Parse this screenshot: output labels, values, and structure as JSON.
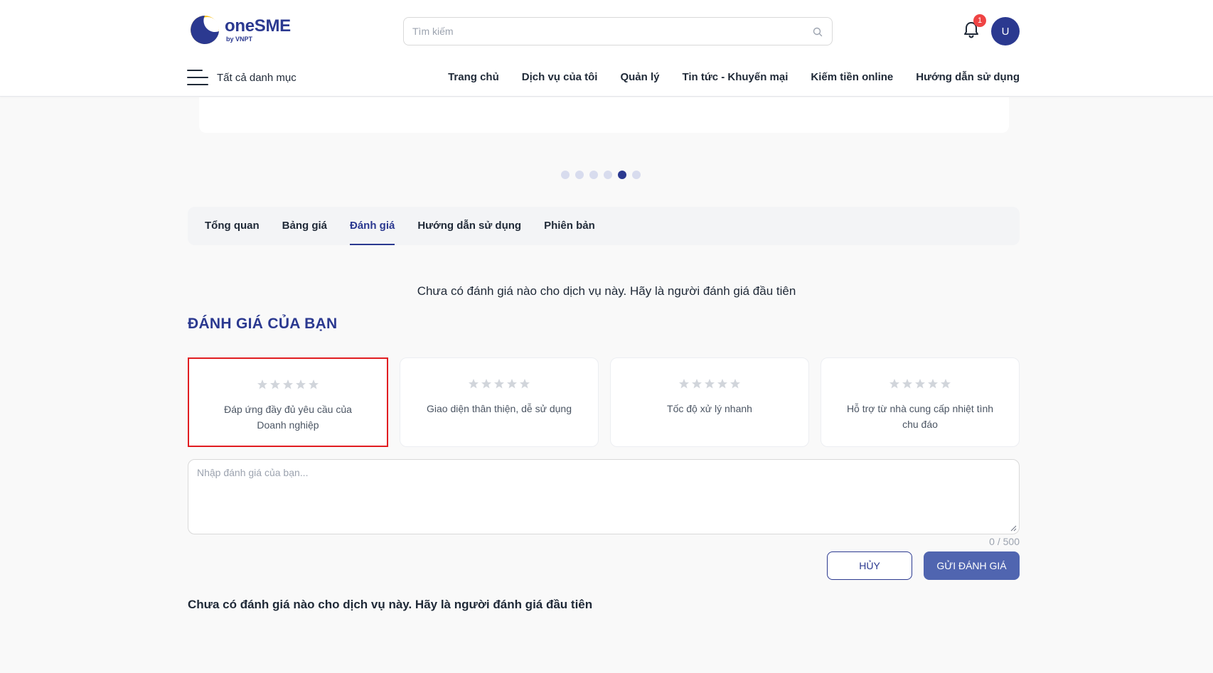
{
  "brand": {
    "name": "oneSME",
    "sub": "by VNPT",
    "color": "#2b3990",
    "accent": "#f9c11c"
  },
  "search": {
    "placeholder": "Tìm kiếm",
    "value": ""
  },
  "notifications": {
    "count": "1"
  },
  "user": {
    "initial": "U"
  },
  "menu": {
    "label": "Tất cả danh mục"
  },
  "nav": [
    {
      "label": "Trang chủ"
    },
    {
      "label": "Dịch vụ của tôi"
    },
    {
      "label": "Quản lý"
    },
    {
      "label": "Tin tức - Khuyến mại"
    },
    {
      "label": "Kiếm tiền online"
    },
    {
      "label": "Hướng dẫn sử dụng"
    }
  ],
  "carousel": {
    "slide_count": 6,
    "active_index": 4
  },
  "tabs": [
    {
      "label": "Tổng quan",
      "active": false
    },
    {
      "label": "Bảng giá",
      "active": false
    },
    {
      "label": "Đánh giá",
      "active": true
    },
    {
      "label": "Hướng dẫn sử dụng",
      "active": false
    },
    {
      "label": "Phiên bản",
      "active": false
    }
  ],
  "review": {
    "empty_message": "Chưa có đánh giá nào cho dịch vụ này. Hãy là người đánh giá đầu tiên",
    "section_title": "ĐÁNH GIÁ CỦA BẠN",
    "criteria": [
      {
        "label": "Đáp ứng đầy đủ yêu cầu của Doanh nghiệp",
        "rating": 0,
        "selected": true
      },
      {
        "label": "Giao diện thân thiện, dễ sử dụng",
        "rating": 0,
        "selected": false
      },
      {
        "label": "Tốc độ xử lý nhanh",
        "rating": 0,
        "selected": false
      },
      {
        "label": "Hỗ trợ từ nhà cung cấp nhiệt tình chu đáo",
        "rating": 0,
        "selected": false
      }
    ],
    "max_rating": 5,
    "textarea_placeholder": "Nhập đánh giá của bạn...",
    "counter": "0 / 500",
    "cancel_label": "HỦY",
    "submit_label": "GỬI ĐÁNH GIÁ",
    "bottom_message": "Chưa có đánh giá nào cho dịch vụ này. Hãy là người đánh giá đầu tiên"
  },
  "colors": {
    "primary": "#2b3990",
    "submit_bg": "#5065b0",
    "highlight_border": "#e11d21",
    "star_empty": "#d1d5db"
  },
  "icons": {
    "search": "search-icon",
    "bell": "bell-icon",
    "menu": "hamburger-icon",
    "star": "star-icon"
  }
}
